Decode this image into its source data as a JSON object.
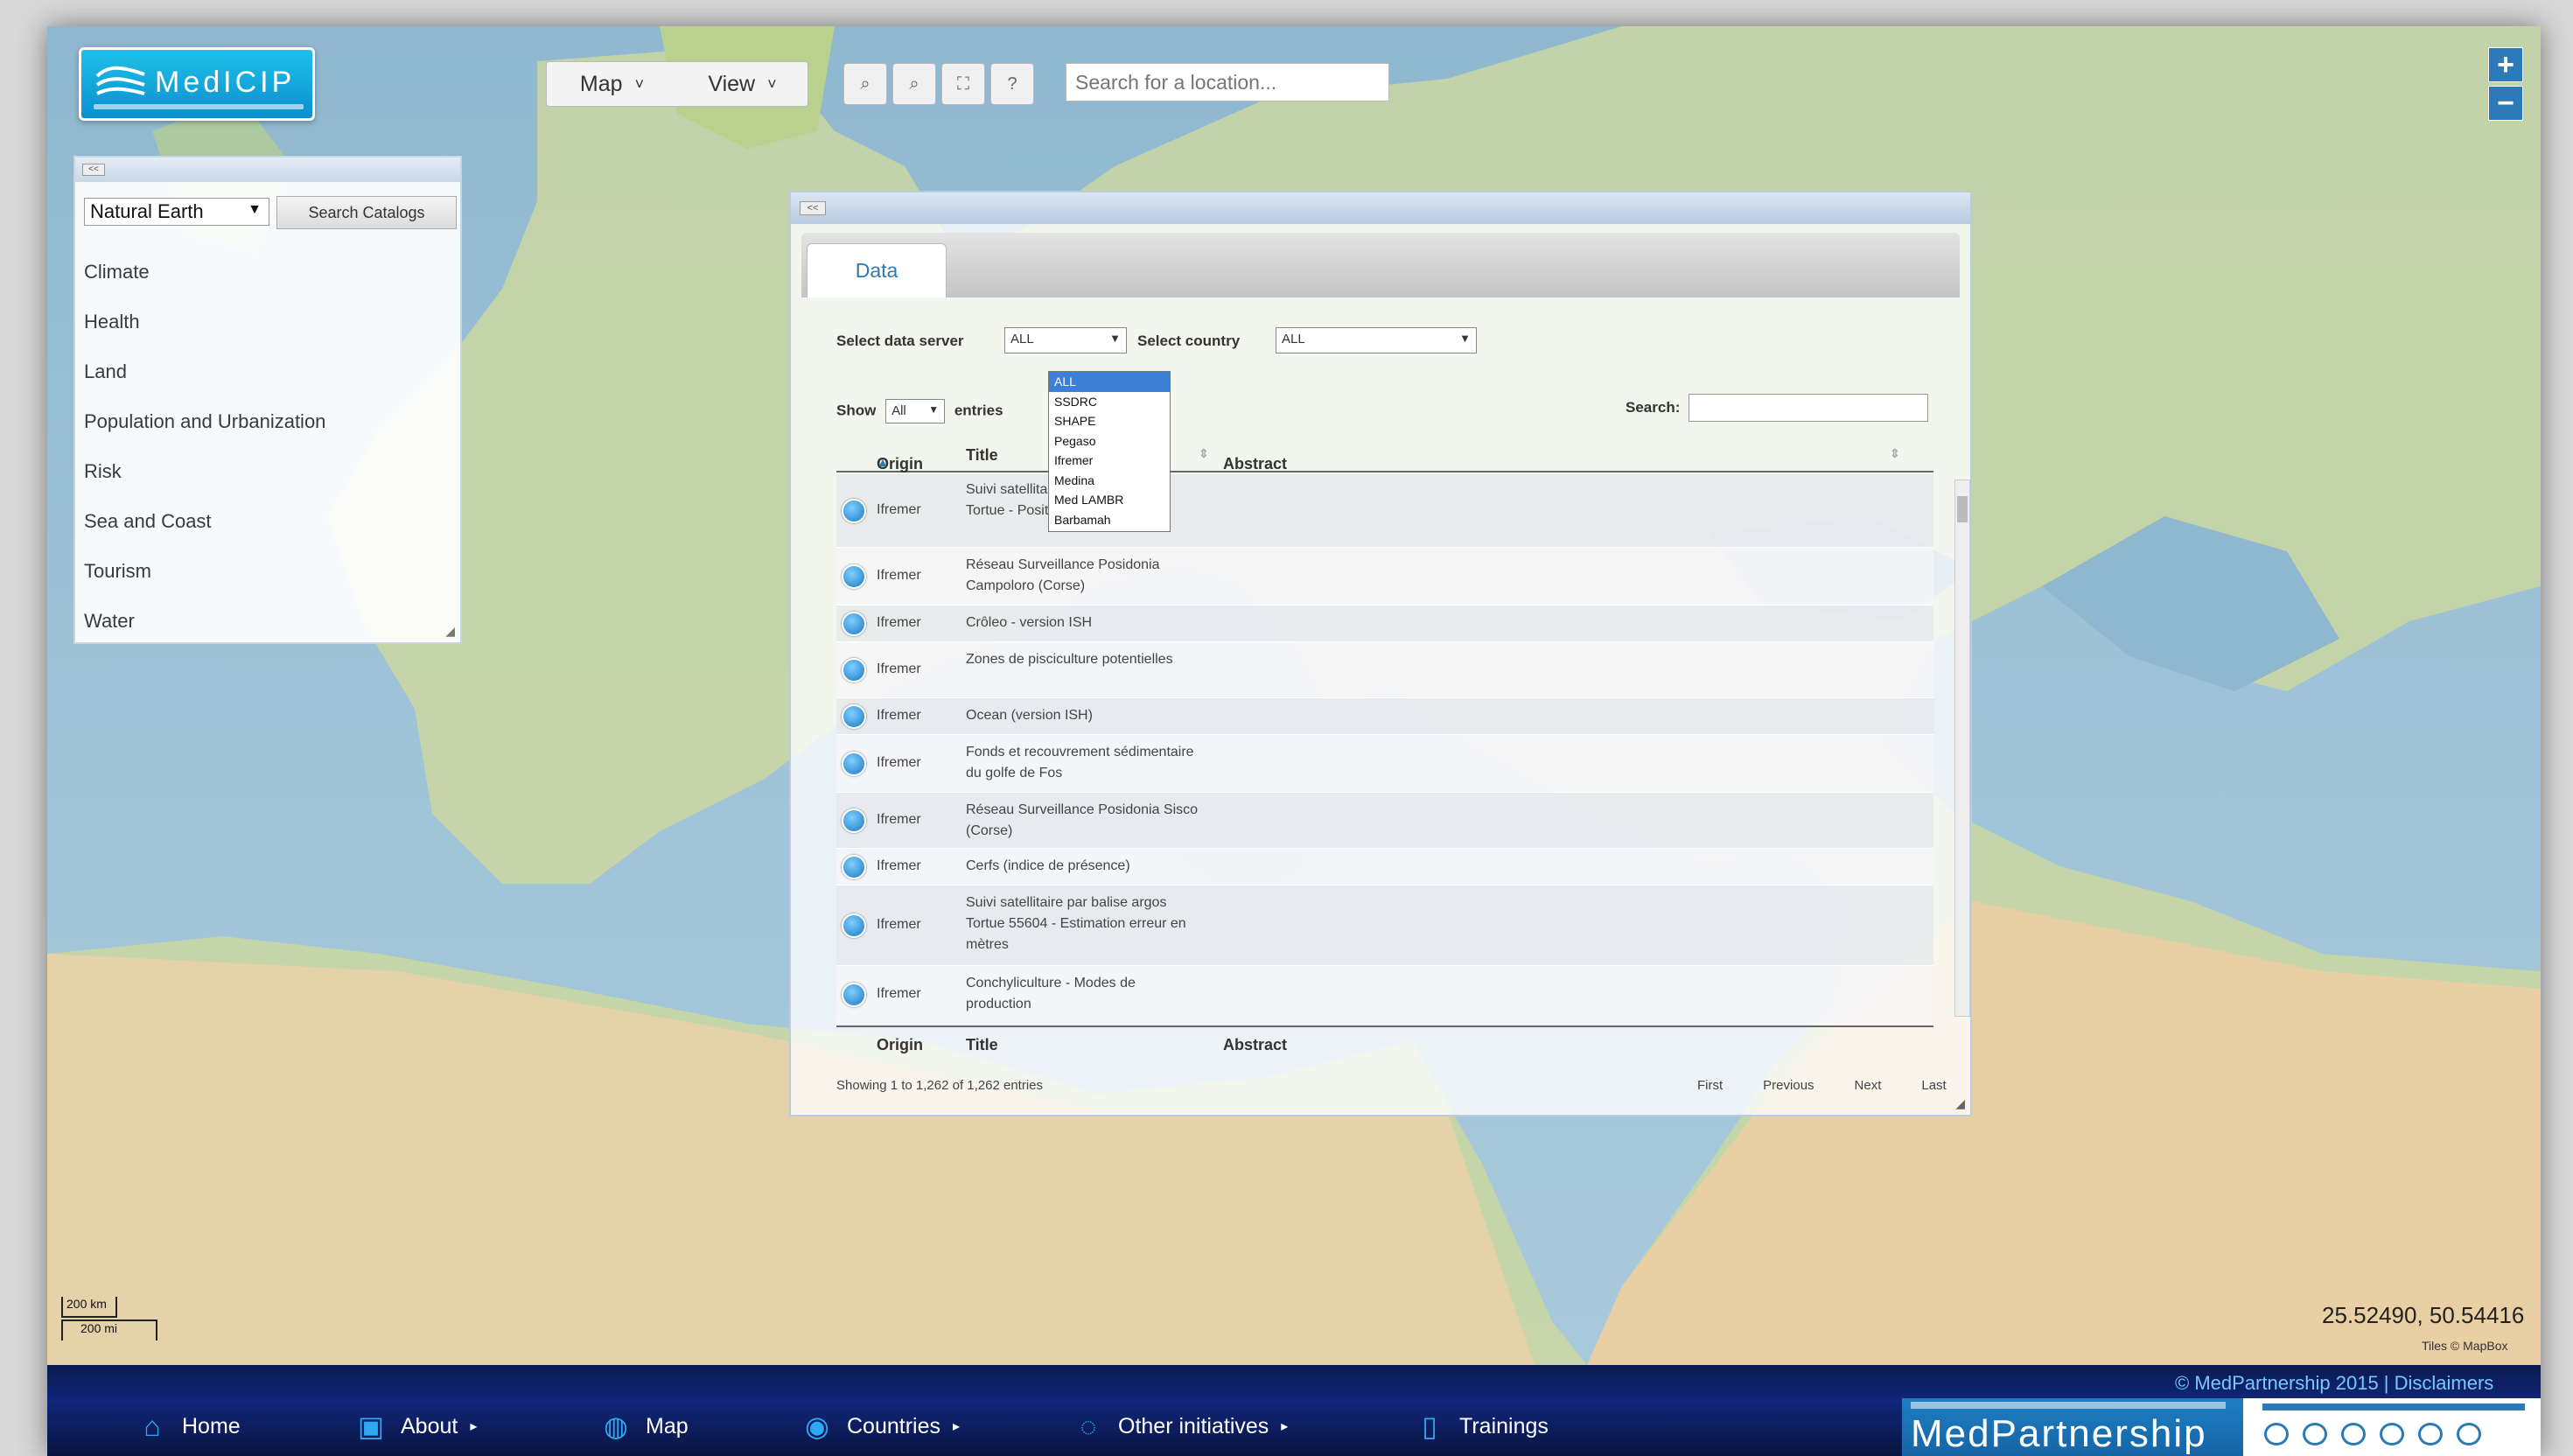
{
  "logo": {
    "text": "MedICIP"
  },
  "menubar": {
    "map_label": "Map",
    "view_label": "View"
  },
  "search_location": {
    "placeholder": "Search for a location..."
  },
  "catalog": {
    "source_value": "Natural Earth",
    "search_button": "Search Catalogs",
    "items": [
      "Climate",
      "Health",
      "Land",
      "Population and Urbanization",
      "Risk",
      "Sea and Coast",
      "Tourism",
      "Water"
    ]
  },
  "dialog": {
    "tab_label": "Data",
    "data_server_label": "Select data server",
    "data_server_value": "ALL",
    "country_label": "Select country",
    "country_value": "ALL",
    "server_options": [
      "ALL",
      "SSDRC",
      "SHAPE",
      "Pegaso",
      "Ifremer",
      "Medina",
      "Med LAMBR",
      "Barbamah"
    ],
    "show_label": "Show",
    "show_value": "All",
    "entries_label": "entries",
    "search_label": "Search:",
    "columns": {
      "origin": "Origin",
      "title": "Title",
      "abstract": "Abstract"
    },
    "rows": [
      {
        "origin": "Ifremer",
        "title": "Suivi satellitaire par balise argos Tortue - Position par état"
      },
      {
        "origin": "Ifremer",
        "title": "Réseau Surveillance Posidonia Campoloro (Corse)"
      },
      {
        "origin": "Ifremer",
        "title": "Crôleo - version ISH"
      },
      {
        "origin": "Ifremer",
        "title": "Zones de pisciculture potentielles"
      },
      {
        "origin": "Ifremer",
        "title": "Ocean (version ISH)"
      },
      {
        "origin": "Ifremer",
        "title": "Fonds et recouvrement sédimentaire du golfe de Fos"
      },
      {
        "origin": "Ifremer",
        "title": "Réseau Surveillance Posidonia Sisco (Corse)"
      },
      {
        "origin": "Ifremer",
        "title": "Cerfs (indice de présence)"
      },
      {
        "origin": "Ifremer",
        "title": "Suivi satellitaire par balise argos Tortue 55604 - Estimation erreur en mètres"
      },
      {
        "origin": "Ifremer",
        "title": "Conchyliculture - Modes de production"
      }
    ],
    "status": "Showing 1 to 1,262 of 1,262 entries",
    "pager": [
      "First",
      "Previous",
      "Next",
      "Last"
    ]
  },
  "scale": {
    "top": "200 km",
    "bottom": "200 mi"
  },
  "coords": "25.52490, 50.54416",
  "tiles_credit": "Tiles © MapBox",
  "bottomnav": {
    "items": [
      "Home",
      "About",
      "Map",
      "Countries",
      "Other initiatives",
      "Trainings"
    ],
    "copyright": "© MedPartnership 2015 | Disclaimers",
    "partner_name": "MedPartnership"
  },
  "colors": {
    "accent": "#2a7ab8",
    "nav_bg": "#10267a",
    "logo_bg": "#0b8fcf"
  }
}
